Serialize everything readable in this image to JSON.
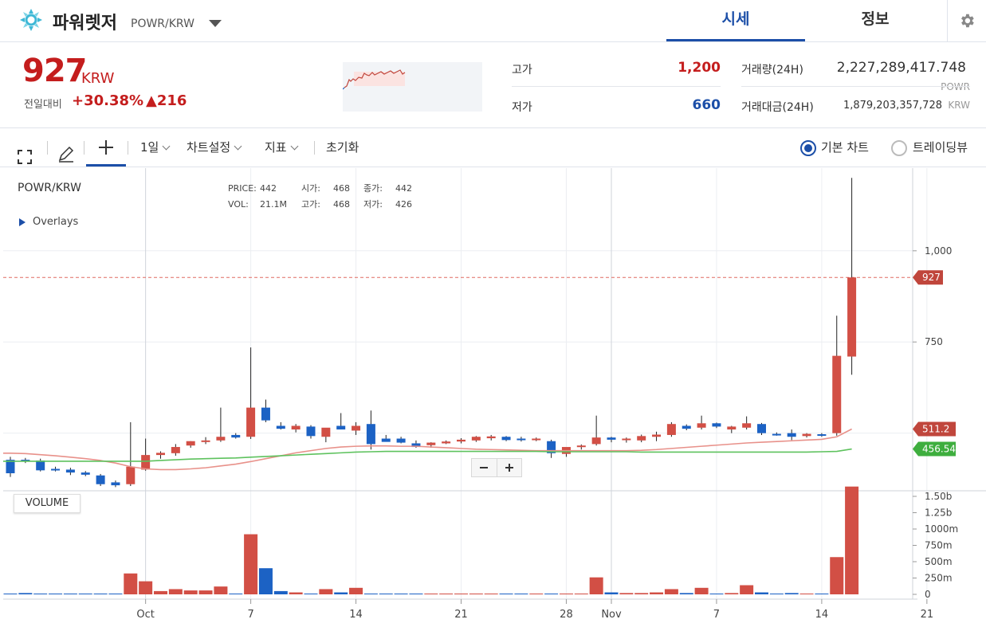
{
  "header": {
    "coin_name": "파워렛저",
    "pair": "POWR/KRW",
    "tabs": [
      {
        "label": "시세",
        "active": true
      },
      {
        "label": "정보",
        "active": false
      }
    ]
  },
  "ticker": {
    "price": "927",
    "unit": "KRW",
    "change_label": "전일대비",
    "change_pct": "+30.38%",
    "change_abs": "▲216",
    "high_label": "고가",
    "high": "1,200",
    "low_label": "저가",
    "low": "660",
    "volume_label": "거래량(24H)",
    "volume": "2,227,289,417.748",
    "volume_unit": "POWR",
    "amount_label": "거래대금(24H)",
    "amount": "1,879,203,357,728",
    "amount_unit": "KRW"
  },
  "toolbar": {
    "interval": "1일",
    "chart_settings": "차트설정",
    "indicators": "지표",
    "reset": "초기화",
    "basic_chart": "기본 차트",
    "trading_view": "트레이딩뷰"
  },
  "colors": {
    "up": "#d24f45",
    "down": "#1c62c4",
    "accent": "#1c4fa8",
    "ma_fast": "#e8918a",
    "ma_slow": "#5ec25e"
  },
  "chart_data": {
    "type": "candlestick",
    "title": "POWR/KRW",
    "overlays_label": "Overlays",
    "legend": {
      "price_label": "PRICE:",
      "price": "442",
      "open_label": "시가:",
      "open": "468",
      "close_label": "종가:",
      "close": "442",
      "vol_label": "VOL:",
      "vol": "21.1M",
      "high_label": "고가:",
      "high": "468",
      "low_label": "저가:",
      "low": "426"
    },
    "price_ticks": [
      {
        "v": 1000,
        "label": "1,000"
      },
      {
        "v": 750,
        "label": "750"
      }
    ],
    "price_badges": [
      {
        "v": 927,
        "label": "927",
        "color": "#c0463c"
      },
      {
        "v": 511.2,
        "label": "511.2",
        "color": "#c0463c"
      },
      {
        "v": 456.54,
        "label": "456.54",
        "color": "#3eae3e"
      }
    ],
    "volume_label": "VOLUME",
    "volume_ticks": [
      {
        "v": 1.5,
        "label": "1.50b"
      },
      {
        "v": 1.25,
        "label": "1.25b"
      },
      {
        "v": 1.0,
        "label": "1000m"
      },
      {
        "v": 0.75,
        "label": "750m"
      },
      {
        "v": 0.5,
        "label": "500m"
      },
      {
        "v": 0.25,
        "label": "250m"
      },
      {
        "v": 0,
        "label": "0"
      }
    ],
    "x_ticks": [
      {
        "i": 9,
        "label": "Oct"
      },
      {
        "i": 16,
        "label": "7"
      },
      {
        "i": 23,
        "label": "14"
      },
      {
        "i": 30,
        "label": "21"
      },
      {
        "i": 37,
        "label": "28"
      },
      {
        "i": 40,
        "label": "Nov"
      },
      {
        "i": 47,
        "label": "7"
      },
      {
        "i": 54,
        "label": "14"
      },
      {
        "i": 61,
        "label": "21"
      }
    ],
    "candles": [
      {
        "o": 427,
        "h": 435,
        "l": 380,
        "c": 390
      },
      {
        "o": 427,
        "h": 432,
        "l": 418,
        "c": 425
      },
      {
        "o": 425,
        "h": 430,
        "l": 395,
        "c": 398
      },
      {
        "o": 402,
        "h": 408,
        "l": 395,
        "c": 398
      },
      {
        "o": 400,
        "h": 405,
        "l": 385,
        "c": 392
      },
      {
        "o": 392,
        "h": 396,
        "l": 382,
        "c": 386
      },
      {
        "o": 384,
        "h": 388,
        "l": 355,
        "c": 360
      },
      {
        "o": 365,
        "h": 370,
        "l": 352,
        "c": 357
      },
      {
        "o": 360,
        "h": 530,
        "l": 355,
        "c": 408
      },
      {
        "o": 400,
        "h": 485,
        "l": 397,
        "c": 440
      },
      {
        "o": 440,
        "h": 450,
        "l": 430,
        "c": 446
      },
      {
        "o": 445,
        "h": 470,
        "l": 438,
        "c": 462
      },
      {
        "o": 466,
        "h": 478,
        "l": 460,
        "c": 478
      },
      {
        "o": 478,
        "h": 489,
        "l": 470,
        "c": 480
      },
      {
        "o": 480,
        "h": 570,
        "l": 476,
        "c": 490
      },
      {
        "o": 495,
        "h": 500,
        "l": 485,
        "c": 488
      },
      {
        "o": 490,
        "h": 735,
        "l": 484,
        "c": 570
      },
      {
        "o": 570,
        "h": 592,
        "l": 530,
        "c": 535
      },
      {
        "o": 520,
        "h": 530,
        "l": 510,
        "c": 512
      },
      {
        "o": 510,
        "h": 525,
        "l": 502,
        "c": 520
      },
      {
        "o": 518,
        "h": 522,
        "l": 485,
        "c": 492
      },
      {
        "o": 490,
        "h": 512,
        "l": 475,
        "c": 515
      },
      {
        "o": 520,
        "h": 555,
        "l": 512,
        "c": 510
      },
      {
        "o": 507,
        "h": 530,
        "l": 495,
        "c": 520
      },
      {
        "o": 525,
        "h": 562,
        "l": 455,
        "c": 470
      },
      {
        "o": 485,
        "h": 495,
        "l": 480,
        "c": 476
      },
      {
        "o": 485,
        "h": 490,
        "l": 472,
        "c": 474
      },
      {
        "o": 472,
        "h": 480,
        "l": 460,
        "c": 462
      },
      {
        "o": 467,
        "h": 475,
        "l": 460,
        "c": 474
      },
      {
        "o": 472,
        "h": 480,
        "l": 470,
        "c": 477
      },
      {
        "o": 477,
        "h": 486,
        "l": 472,
        "c": 482
      },
      {
        "o": 480,
        "h": 492,
        "l": 476,
        "c": 490
      },
      {
        "o": 486,
        "h": 495,
        "l": 480,
        "c": 491
      },
      {
        "o": 490,
        "h": 492,
        "l": 478,
        "c": 481
      },
      {
        "o": 485,
        "h": 490,
        "l": 477,
        "c": 482
      },
      {
        "o": 482,
        "h": 488,
        "l": 478,
        "c": 485
      },
      {
        "o": 478,
        "h": 482,
        "l": 432,
        "c": 445
      },
      {
        "o": 443,
        "h": 448,
        "l": 435,
        "c": 462
      },
      {
        "o": 462,
        "h": 469,
        "l": 455,
        "c": 466
      },
      {
        "o": 470,
        "h": 548,
        "l": 466,
        "c": 488
      },
      {
        "o": 488,
        "h": 490,
        "l": 475,
        "c": 482
      },
      {
        "o": 482,
        "h": 488,
        "l": 474,
        "c": 485
      },
      {
        "o": 480,
        "h": 496,
        "l": 475,
        "c": 492
      },
      {
        "o": 490,
        "h": 504,
        "l": 478,
        "c": 496
      },
      {
        "o": 495,
        "h": 530,
        "l": 490,
        "c": 525
      },
      {
        "o": 520,
        "h": 524,
        "l": 508,
        "c": 512
      },
      {
        "o": 515,
        "h": 548,
        "l": 510,
        "c": 527
      },
      {
        "o": 527,
        "h": 529,
        "l": 514,
        "c": 518
      },
      {
        "o": 510,
        "h": 520,
        "l": 500,
        "c": 518
      },
      {
        "o": 515,
        "h": 546,
        "l": 510,
        "c": 527
      },
      {
        "o": 525,
        "h": 528,
        "l": 495,
        "c": 500
      },
      {
        "o": 498,
        "h": 502,
        "l": 493,
        "c": 495
      },
      {
        "o": 500,
        "h": 510,
        "l": 481,
        "c": 490
      },
      {
        "o": 492,
        "h": 500,
        "l": 488,
        "c": 498
      },
      {
        "o": 497,
        "h": 500,
        "l": 490,
        "c": 496
      },
      {
        "o": 500,
        "h": 822,
        "l": 493,
        "c": 712
      },
      {
        "o": 710,
        "h": 1200,
        "l": 660,
        "c": 927
      }
    ],
    "volumes": [
      0.01,
      0.02,
      0.01,
      0.01,
      0,
      0.01,
      0.01,
      0.01,
      0.32,
      0.2,
      0.05,
      0.08,
      0.06,
      0.06,
      0.12,
      0,
      0.92,
      0.4,
      0.05,
      0.03,
      0,
      0.08,
      0.03,
      0.1,
      0.01,
      0,
      0,
      0,
      0,
      0,
      0,
      0,
      0,
      0,
      0,
      0.01,
      0.01,
      0.01,
      0,
      0.26,
      0.03,
      0.02,
      0.02,
      0.03,
      0.08,
      0.02,
      0.1,
      0.01,
      0.02,
      0.14,
      0.03,
      0.01,
      0.02,
      0.01,
      0,
      0.57,
      1.65
    ],
    "ma_fast": [
      445,
      444,
      441,
      438,
      434,
      430,
      425,
      418,
      408,
      402,
      400,
      400,
      402,
      405,
      410,
      415,
      422,
      430,
      438,
      446,
      452,
      458,
      462,
      464,
      465,
      465,
      464,
      464,
      462,
      460,
      458,
      456,
      455,
      454,
      453,
      452,
      452,
      452,
      452,
      452,
      452,
      452,
      453,
      455,
      458,
      461,
      464,
      467,
      470,
      473,
      475,
      477,
      479,
      481,
      483,
      490,
      511.2
    ],
    "ma_slow": [
      423,
      423,
      423,
      423,
      423,
      423,
      423,
      423,
      423,
      423,
      425,
      427,
      429,
      430,
      431,
      432,
      434,
      436,
      438,
      440,
      442,
      444,
      446,
      448,
      449,
      450,
      450,
      450,
      450,
      450,
      450,
      450,
      450,
      450,
      450,
      450,
      449,
      449,
      449,
      449,
      449,
      449,
      448,
      448,
      448,
      448,
      448,
      448,
      448,
      448,
      448,
      448,
      448,
      448,
      449,
      450,
      456.54
    ]
  }
}
